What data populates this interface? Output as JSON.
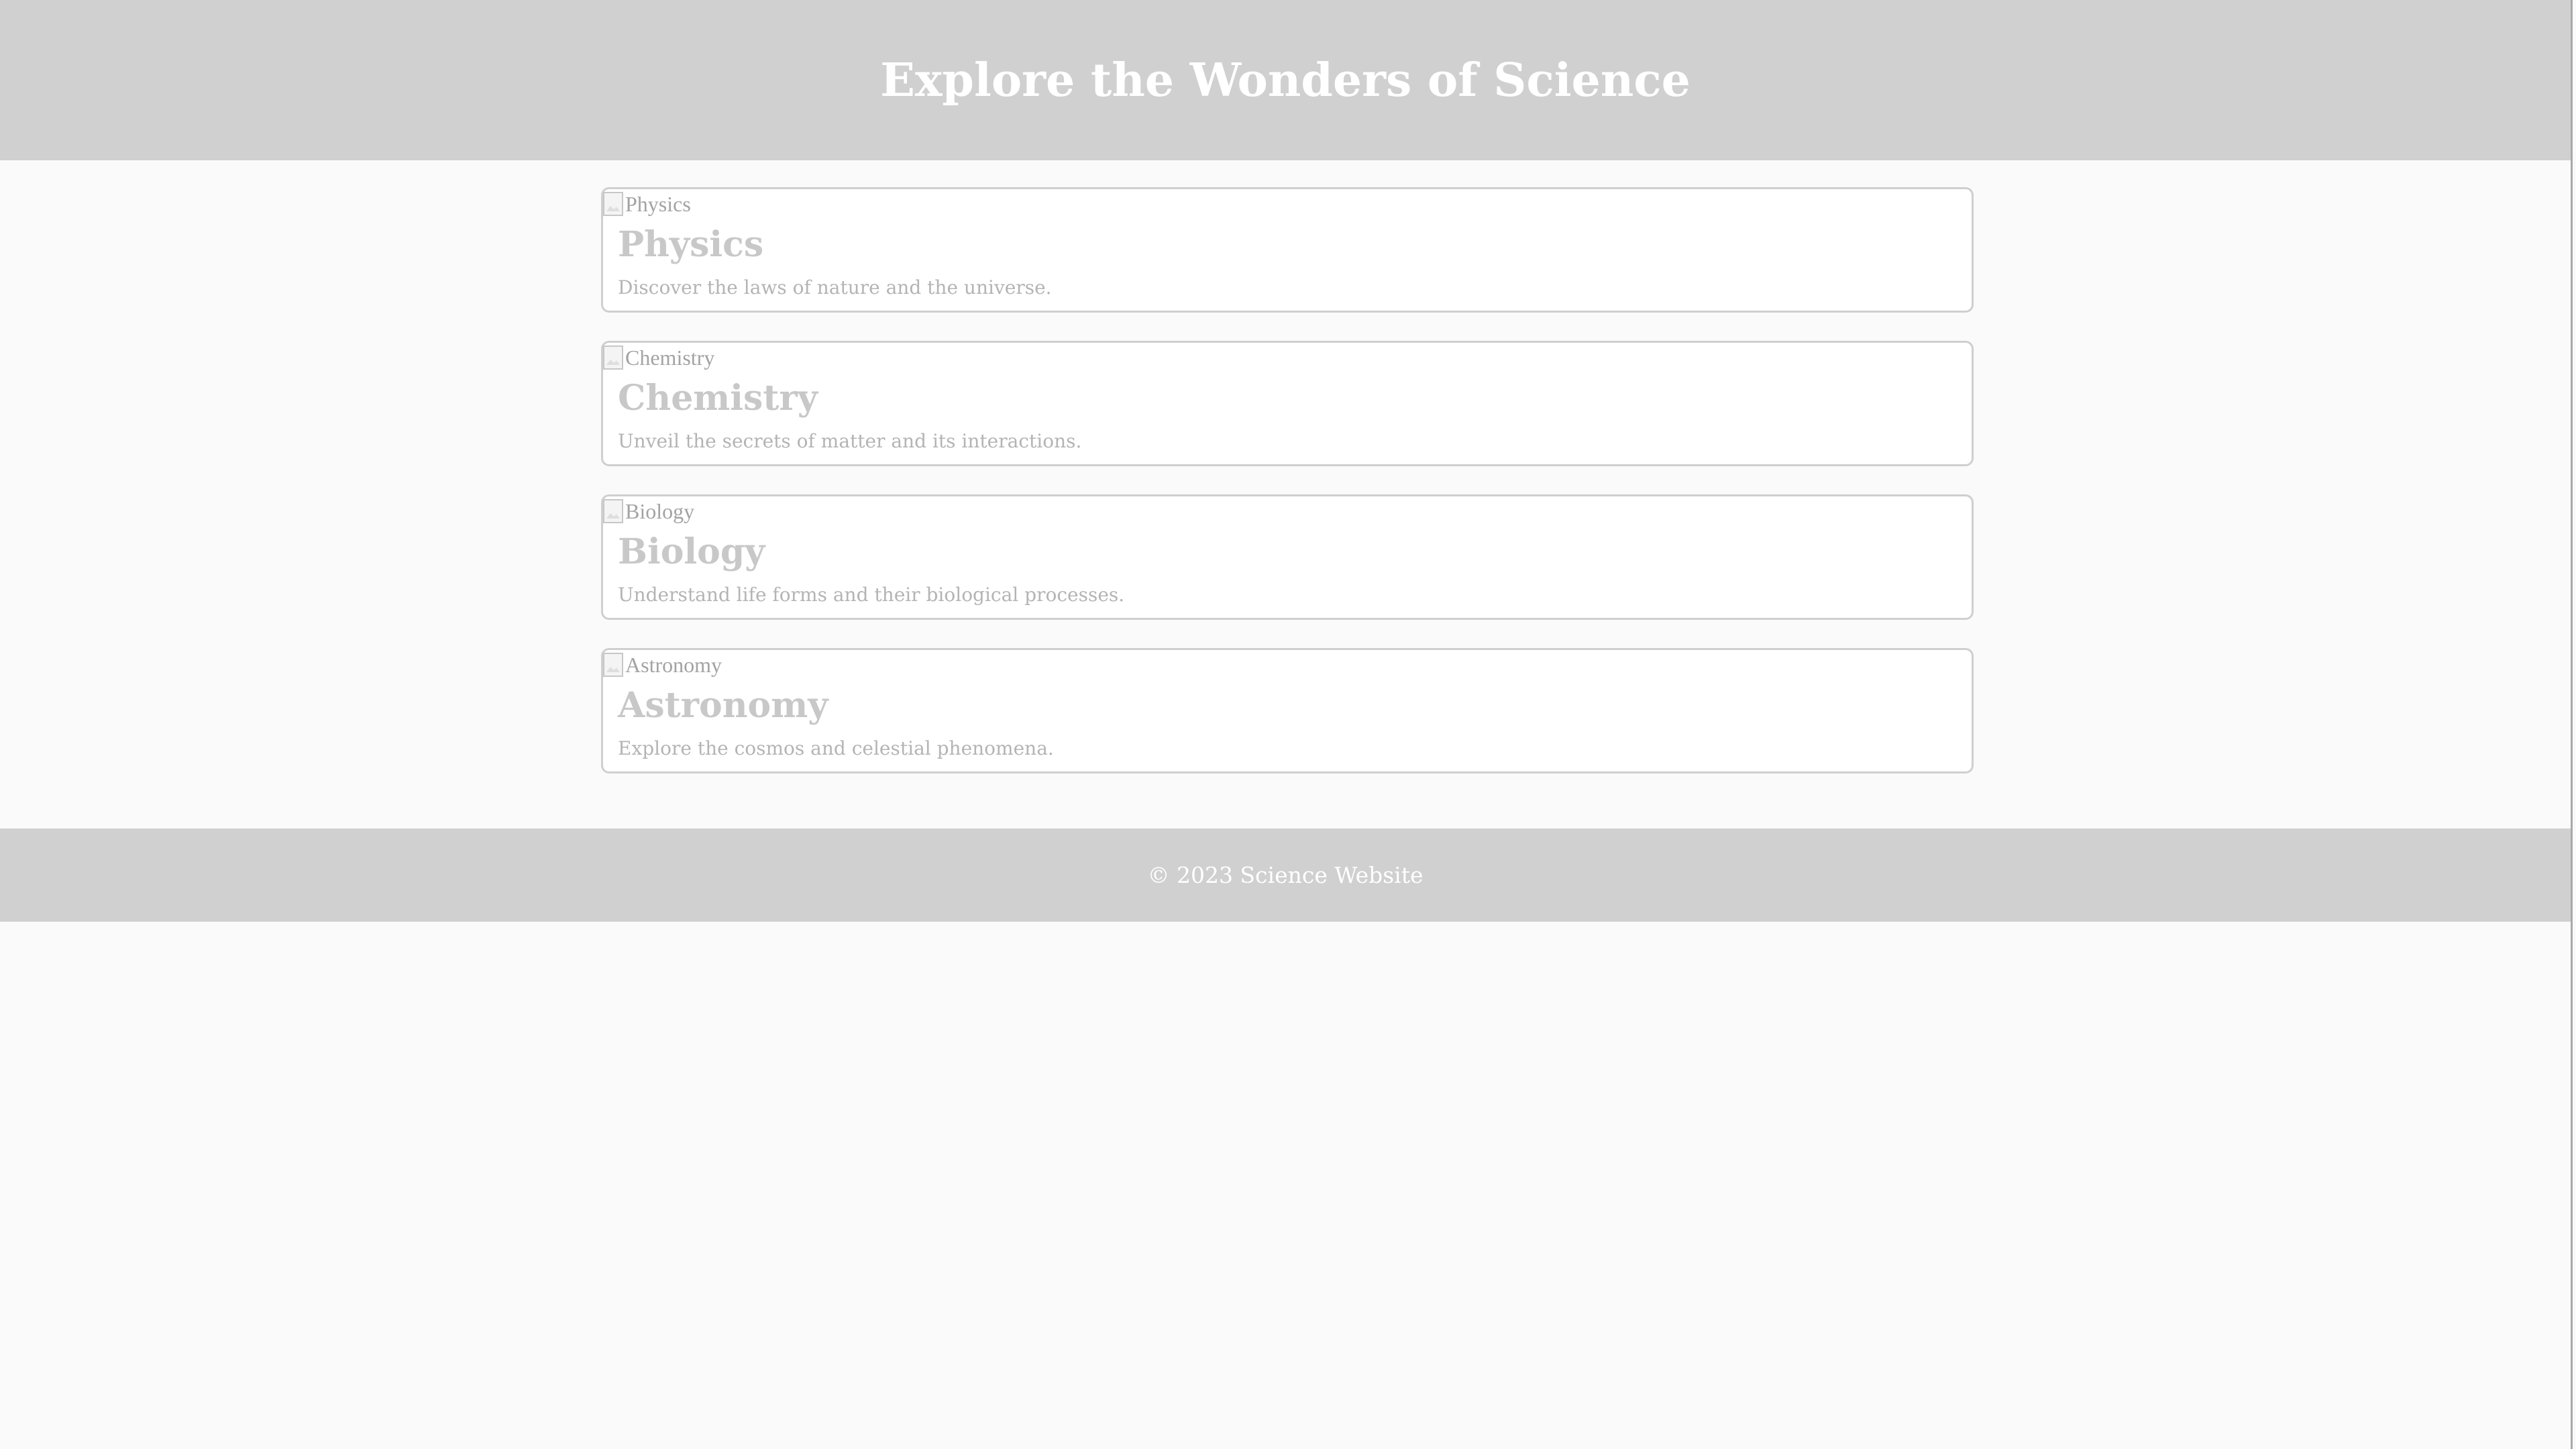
{
  "header": {
    "title": "Explore the Wonders of Science"
  },
  "cards": [
    {
      "image_alt": "Physics",
      "title": "Physics",
      "description": "Discover the laws of nature and the universe."
    },
    {
      "image_alt": "Chemistry",
      "title": "Chemistry",
      "description": "Unveil the secrets of matter and its interactions."
    },
    {
      "image_alt": "Biology",
      "title": "Biology",
      "description": "Understand life forms and their biological processes."
    },
    {
      "image_alt": "Astronomy",
      "title": "Astronomy",
      "description": "Explore the cosmos and celestial phenomena."
    }
  ],
  "footer": {
    "text": "© 2023 Science Website"
  },
  "colors": {
    "bar_background": "#d0d0d0",
    "page_background": "#fafafa",
    "card_border": "#cfcfcf",
    "heading_text": "#ffffff"
  }
}
